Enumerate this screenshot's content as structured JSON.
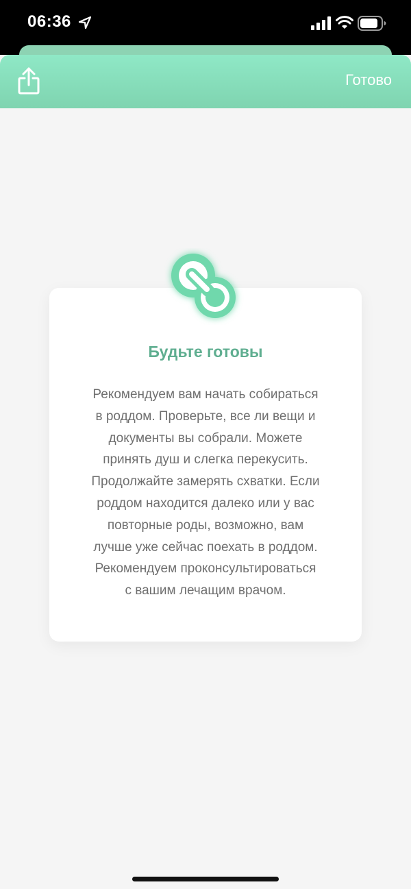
{
  "status_bar": {
    "time": "06:36",
    "icons": [
      "location-arrow-icon",
      "signal-bars-icon",
      "wifi-icon",
      "battery-icon"
    ]
  },
  "top_bar": {
    "share_icon": "share-icon",
    "done_label": "Готово",
    "background_color": "#8fe8c6"
  },
  "card": {
    "icon": "pacifier-icon",
    "title": "Будьте готовы",
    "body_lines": [
      "Рекомендуем вам начать собираться",
      "в роддом. Проверьте, все ли вещи и",
      "документы вы собрали. Можете",
      "принять душ и слегка перекусить.",
      "Продолжайте замерять схватки. Если",
      "роддом находится далеко или у вас",
      "повторные роды, возможно, вам",
      "лучше уже сейчас поехать в роддом.",
      "Рекомендуем проконсультироваться",
      "с вашим лечащим врачом."
    ],
    "title_color": "#5fae90",
    "accent_color": "#6fd8ac"
  }
}
